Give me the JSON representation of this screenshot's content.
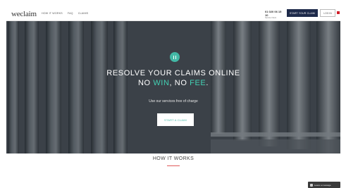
{
  "brand": {
    "logo_text": "weclaim"
  },
  "nav": {
    "links": [
      "HOW IT WORKS",
      "FAQ",
      "CLAIMS"
    ],
    "phone_number": "01 020 06 15 10",
    "phone_sub": "Service Client",
    "start_claim_label": "START YOUR CLAIM",
    "login_label": "LOG IN"
  },
  "hero": {
    "title_line1": "RESOLVE YOUR CLAIMS ONLINE",
    "title_line2_part1": "NO ",
    "title_line2_win": "WIN",
    "title_line2_part2": ", NO ",
    "title_line2_fee": "FEE",
    "title_line2_end": ".",
    "subtitle": "Use our services free of charge",
    "cta_label": "START A CLAIM"
  },
  "section": {
    "how_it_works_title": "HOW IT WORKS"
  },
  "chip": {
    "label": "Leave a message"
  },
  "colors": {
    "accent": "#43d0b3",
    "navy": "#1e2a4a",
    "divider": "#e15a5a"
  },
  "icons": {
    "hero_icon": "pause-icon",
    "flag": "flag-icon",
    "chip_icon": "chat-icon"
  }
}
